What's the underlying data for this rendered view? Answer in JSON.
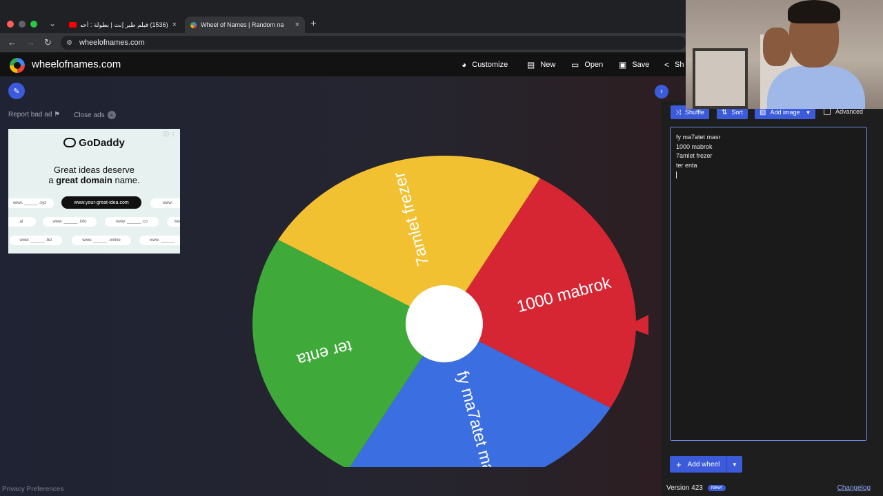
{
  "browser": {
    "tabs": [
      {
        "title": "(1536) فيلم طير إنت | بطولة : أحمـ",
        "close": "×"
      },
      {
        "title": "Wheel of Names | Random na",
        "close": "×"
      }
    ],
    "tab_list_icon": "⌄",
    "new_tab": "+",
    "url": "wheelofnames.com"
  },
  "app": {
    "site_name": "wheelofnames.com",
    "header_buttons": [
      {
        "label": "Customize",
        "icon": "palette-icon"
      },
      {
        "label": "New",
        "icon": "file-icon"
      },
      {
        "label": "Open",
        "icon": "folder-icon"
      },
      {
        "label": "Save",
        "icon": "save-icon"
      },
      {
        "label": "Sh",
        "icon": "share-icon"
      }
    ]
  },
  "ad": {
    "report_label": "Report bad ad",
    "close_label": "Close ads",
    "brand": "GoDaddy",
    "headline_line1": "Great ideas deserve",
    "headline_a": "a ",
    "headline_bold": "great domain",
    "headline_b": " name.",
    "cta": "www.your-great-idea.com",
    "pills": [
      "www. ______ .xyz",
      "www.",
      ".ai",
      "www. ______ .info",
      "www. ______ .co",
      "ww",
      "www. ______ .biz",
      "www. ______ .online",
      "www. ______"
    ]
  },
  "wheel": {
    "segments": [
      {
        "label": "1000 mabrok",
        "color": "#d62634"
      },
      {
        "label": "fy ma7atet masr",
        "color": "#3b6ee0"
      },
      {
        "label": "ter enta",
        "color": "#3faa3a"
      },
      {
        "label": "7amlet frezer",
        "color": "#f2c132"
      }
    ],
    "pointer_color": "#d62634"
  },
  "panel": {
    "shuffle": "Shuffle",
    "sort": "Sort",
    "add_image": "Add image",
    "advanced": "Advanced",
    "entries": [
      "fy ma7atet masr",
      "1000 mabrok",
      "7amlet frezer",
      "ter enta"
    ],
    "add_wheel": "Add wheel",
    "version": "Version 423",
    "new_badge": "New!",
    "changelog": "Changelog"
  },
  "footer": {
    "privacy": "Privacy Preferences"
  }
}
